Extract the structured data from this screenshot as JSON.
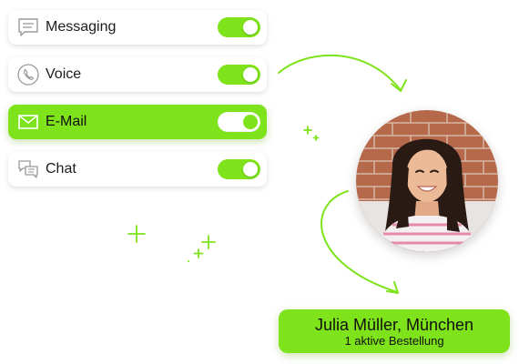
{
  "accent_color": "#7ee31a",
  "channels": [
    {
      "label": "Messaging",
      "icon": "message-icon",
      "enabled": true,
      "selected": false
    },
    {
      "label": "Voice",
      "icon": "phone-icon",
      "enabled": true,
      "selected": false
    },
    {
      "label": "E-Mail",
      "icon": "mail-icon",
      "enabled": true,
      "selected": true
    },
    {
      "label": "Chat",
      "icon": "chat-icon",
      "enabled": true,
      "selected": false
    }
  ],
  "customer": {
    "name": "Julia Müller, München",
    "status": "1 aktive Bestellung"
  }
}
